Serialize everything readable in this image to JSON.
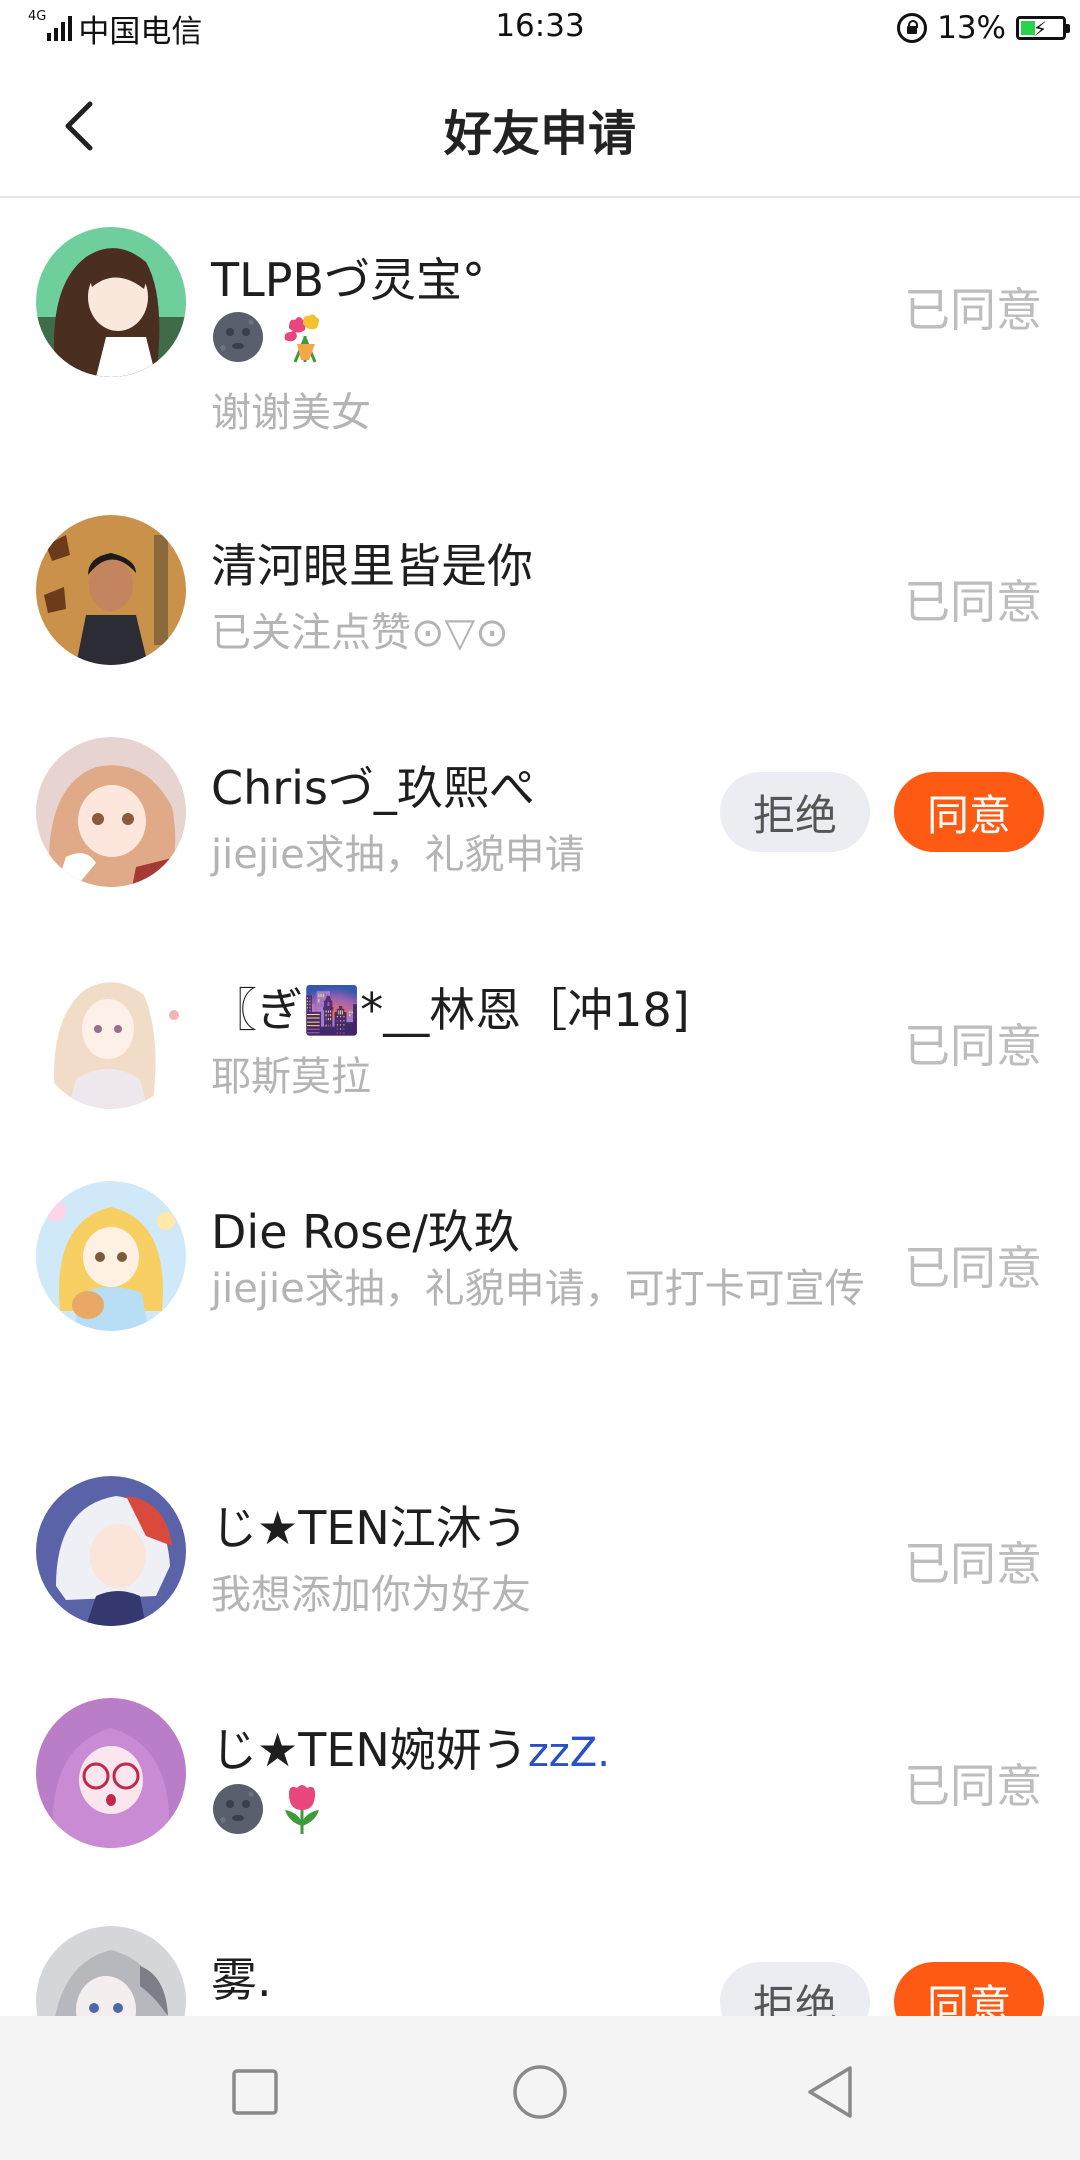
{
  "status_bar": {
    "network": "4G",
    "carrier": "中国电信",
    "time": "16:33",
    "battery_pct": "13%"
  },
  "header": {
    "title": "好友申请"
  },
  "requests": [
    {
      "name": "TLPBづ灵宝°",
      "emoji": [
        "new-moon-face",
        "tulip-bouquet"
      ],
      "message": "谢谢美女",
      "status": "已同意"
    },
    {
      "name": "清河眼里皆是你",
      "message": "已关注点赞⊙▽⊙",
      "status": "已同意"
    },
    {
      "name": "Chrisづ_玖熙ぺ",
      "message": "jiejie求抽，礼貌申请",
      "reject_label": "拒绝",
      "accept_label": "同意"
    },
    {
      "name": "〖ぎ🌆*__林恩［冲18]",
      "message": "耶斯莫拉",
      "status": "已同意"
    },
    {
      "name": "Die Rose/玖玖",
      "message": "jiejie求抽，礼貌申请，可打卡可宣传",
      "status": "已同意"
    },
    {
      "name": "じ★TEN江沐う",
      "message": "我想添加你为好友",
      "status": "已同意"
    },
    {
      "name": "じ★TEN婉妍う",
      "name_suffix": "zzZ.",
      "emoji": [
        "new-moon-face",
        "tulip"
      ],
      "status": "已同意"
    },
    {
      "name": "雾.",
      "reject_label": "拒绝",
      "accept_label": "同意"
    }
  ],
  "colors": {
    "accent": "#ff5a14",
    "reject_bg": "#ebedf2",
    "muted_text": "#b4b4b4",
    "status_text": "#bdbdbd"
  }
}
